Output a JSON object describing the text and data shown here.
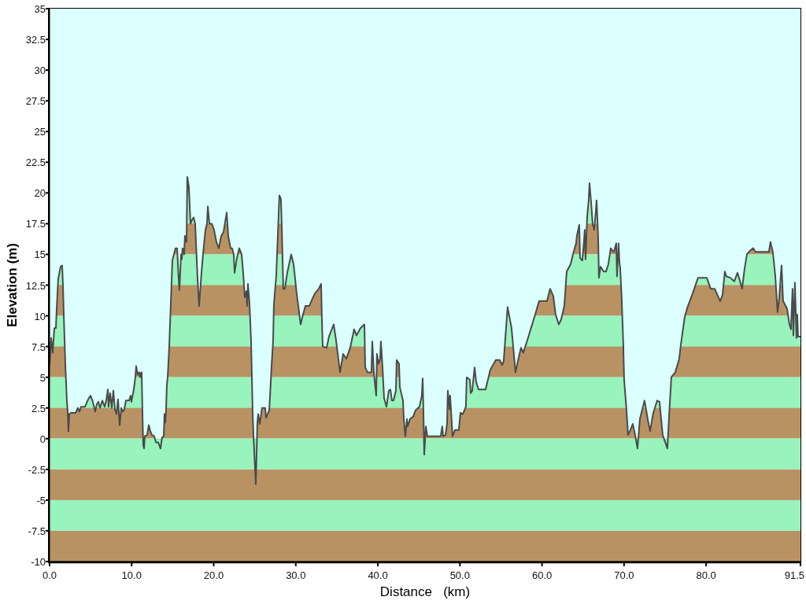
{
  "chart": {
    "chart_data": {
      "type": "area",
      "xlabel": "Distance   (km)",
      "ylabel": "Elevation (m)",
      "x": [
        0,
        0.19,
        0.38,
        0.58,
        0.77,
        0.86,
        1.05,
        1.34,
        1.53,
        1.63,
        1.73,
        1.92,
        2.11,
        2.21,
        2.3,
        2.4,
        2.59,
        3.16,
        3.45,
        3.64,
        3.84,
        4.32,
        4.7,
        4.99,
        5.27,
        5.56,
        5.75,
        5.95,
        6.14,
        6.43,
        6.71,
        6.9,
        7.1,
        7.19,
        7.38,
        7.58,
        7.77,
        7.96,
        8.15,
        8.34,
        8.54,
        8.73,
        8.92,
        9.11,
        9.3,
        9.69,
        9.88,
        9.97,
        10.26,
        10.45,
        10.55,
        10.74,
        10.93,
        11.03,
        11.12,
        11.22,
        11.32,
        11.41,
        11.51,
        11.6,
        11.89,
        12.08,
        12.28,
        12.47,
        12.75,
        12.95,
        13.23,
        13.52,
        13.71,
        13.91,
        14,
        14.1,
        14.19,
        14.29,
        14.39,
        14.58,
        14.77,
        14.96,
        15.15,
        15.34,
        15.54,
        15.73,
        15.82,
        16.02,
        16.11,
        16.21,
        16.4,
        16.49,
        16.69,
        16.78,
        16.97,
        17.07,
        17.17,
        17.36,
        17.55,
        17.74,
        18.03,
        18.22,
        18.51,
        18.7,
        18.99,
        19.18,
        19.28,
        19.47,
        19.76,
        20.04,
        20.33,
        20.62,
        20.91,
        21.19,
        21.48,
        21.58,
        21.77,
        22.06,
        22.25,
        22.44,
        22.54,
        22.82,
        23.11,
        23.4,
        23.59,
        23.78,
        23.98,
        24.07,
        24.17,
        24.36,
        24.55,
        24.65,
        24.74,
        24.84,
        25.13,
        25.32,
        25.42,
        25.61,
        25.89,
        26.28,
        26.37,
        26.76,
        26.85,
        27.04,
        27.24,
        27.33,
        27.62,
        27.81,
        28,
        28.19,
        28.29,
        28.48,
        28.67,
        28.96,
        29.44,
        29.73,
        30.11,
        30.4,
        30.59,
        30.88,
        31.17,
        31.65,
        32.03,
        32.32,
        32.8,
        33.09,
        33.18,
        33.28,
        33.76,
        34.04,
        34.62,
        34.91,
        35.39,
        35.77,
        36.15,
        36.63,
        37.11,
        37.4,
        37.88,
        38.36,
        38.46,
        38.74,
        39.22,
        39.32,
        39.51,
        39.8,
        39.89,
        40.09,
        40.28,
        40.37,
        40.57,
        40.76,
        41.05,
        41.33,
        41.53,
        41.72,
        41.91,
        42.2,
        42.29,
        42.58,
        42.68,
        43.06,
        43.16,
        43.35,
        43.54,
        43.63,
        43.92,
        44.31,
        44.59,
        45.07,
        45.36,
        45.46,
        45.55,
        45.65,
        45.84,
        46.03,
        47.66,
        47.85,
        47.95,
        48.24,
        48.43,
        48.53,
        48.72,
        48.81,
        49.1,
        49.39,
        49.87,
        50.06,
        50.35,
        50.73,
        50.83,
        51.21,
        51.31,
        51.5,
        51.79,
        51.98,
        52.27,
        53.13,
        53.7,
        54.38,
        54.85,
        55.14,
        55.33,
        55.81,
        56.29,
        56.77,
        57.06,
        57.44,
        57.73,
        58.21,
        59.17,
        59.65,
        60.61,
        60.99,
        61.38,
        61.66,
        62.05,
        62.34,
        62.72,
        63.01,
        63.49,
        63.77,
        64.16,
        64.25,
        64.54,
        64.64,
        64.92,
        65.12,
        65.21,
        65.31,
        65.5,
        65.69,
        65.79,
        65.98,
        66.17,
        66.36,
        66.55,
        66.65,
        66.84,
        66.94,
        67.13,
        67.51,
        67.8,
        68.09,
        68.38,
        68.57,
        68.76,
        69.05,
        69.14,
        69.34,
        69.43,
        69.53,
        69.72,
        69.91,
        70.01,
        70.29,
        70.49,
        70.77,
        71.06,
        71.35,
        71.64,
        71.93,
        72.5,
        72.88,
        73.17,
        73.56,
        74.04,
        74.32,
        74.71,
        75.28,
        75.47,
        75.76,
        76.24,
        76.72,
        76.91,
        77.39,
        77.68,
        78.35,
        79.02,
        80.08,
        80.56,
        81.04,
        81.71,
        82,
        82.28,
        82.47,
        82.95,
        83.43,
        83.82,
        84.1,
        84.39,
        84.68,
        84.97,
        85.35,
        85.73,
        86.02,
        87.65,
        87.84,
        88.13,
        88.42,
        88.71,
        88.9,
        89.19,
        89.38,
        89.86,
        90.15,
        90.34,
        90.53,
        90.63,
        90.82,
        91.01,
        91.11,
        91.2,
        91.5
      ],
      "values": [
        6,
        8.2,
        7,
        9,
        9,
        10.5,
        13,
        14,
        14.1,
        12.5,
        10,
        6,
        3,
        2.2,
        0.6,
        2,
        2.1,
        2.1,
        2.5,
        2.2,
        2.6,
        2.6,
        3.2,
        3.5,
        3,
        2.2,
        2.8,
        3,
        2.5,
        3.1,
        2.6,
        3.1,
        4,
        2.6,
        3.7,
        2.5,
        3.9,
        2.4,
        2,
        3.2,
        1.1,
        2.5,
        2.2,
        2.4,
        3.1,
        3.1,
        3.5,
        3,
        4,
        5,
        5.9,
        5.2,
        5.4,
        5,
        5.3,
        5.4,
        2,
        -0.5,
        -0.8,
        0.2,
        0.3,
        1.1,
        0.6,
        0.3,
        0.2,
        -0.3,
        -0.3,
        -0.8,
        0.1,
        0.2,
        2,
        1.3,
        2.3,
        4.4,
        5,
        7.5,
        11,
        14.5,
        15,
        15.5,
        15.5,
        13,
        12.1,
        15,
        14.6,
        15.5,
        15,
        16.5,
        16,
        21.3,
        20.5,
        19,
        17.5,
        17.8,
        18,
        17.5,
        13,
        10.8,
        13.5,
        15,
        17,
        17.5,
        18.9,
        17.5,
        17.5,
        17,
        16,
        15.5,
        16.5,
        16.8,
        18,
        18.4,
        16.5,
        15.5,
        15.5,
        15,
        13.5,
        14.7,
        15.5,
        15,
        13.5,
        11.5,
        12,
        10.8,
        12.6,
        11,
        8,
        5,
        2.2,
        0.3,
        -3.7,
        1.3,
        2,
        1.2,
        2.5,
        2.5,
        1.7,
        2.3,
        3.3,
        5.8,
        8,
        10.9,
        13.3,
        16.5,
        19.8,
        19.5,
        17.3,
        12.2,
        12.2,
        13.5,
        15,
        14.2,
        11.8,
        10.3,
        9.3,
        10.1,
        10.8,
        10.8,
        11.4,
        11.8,
        12.2,
        12.6,
        9.7,
        7.5,
        7.4,
        8.3,
        9.3,
        8,
        5.4,
        6.9,
        6.5,
        7.4,
        8.9,
        8.4,
        9,
        9.3,
        5.8,
        5.4,
        5.4,
        7.9,
        5.4,
        3.5,
        6.9,
        6.1,
        6.5,
        7.9,
        5.8,
        3.3,
        2.6,
        3.9,
        4,
        3.1,
        3.1,
        3.9,
        6.4,
        6.1,
        4.2,
        3.1,
        1.6,
        0.2,
        1.6,
        1,
        1.6,
        1.8,
        2.3,
        2.6,
        3.5,
        4.9,
        2.4,
        -1.3,
        1,
        0.2,
        0.2,
        1,
        0.2,
        0.3,
        1.2,
        3.9,
        2.4,
        3.5,
        0.2,
        0.7,
        0.7,
        2.1,
        2,
        2.6,
        5,
        4.8,
        3.7,
        3.9,
        5.8,
        4.6,
        4,
        4,
        5.6,
        6.4,
        6.4,
        6,
        6.3,
        10.7,
        9,
        5.4,
        6.3,
        7.4,
        7,
        8,
        10.1,
        11.2,
        11.2,
        12.2,
        11.6,
        10.1,
        9.3,
        9.7,
        10.8,
        13.6,
        14.2,
        15,
        15.9,
        16.5,
        17.4,
        14.7,
        14.5,
        16.1,
        17,
        14.6,
        18,
        19.4,
        20.8,
        19.3,
        17.5,
        17,
        18.4,
        19.4,
        16.5,
        13.1,
        14,
        13.6,
        13.6,
        14.2,
        15.5,
        15.3,
        15.2,
        15.9,
        13.2,
        15.9,
        14.4,
        13.9,
        11.3,
        7.6,
        4.8,
        2.4,
        0.3,
        0.7,
        1.2,
        0.3,
        -0.8,
        1.6,
        3.1,
        1.6,
        0.6,
        2.1,
        3.1,
        3,
        0.3,
        -0.8,
        1.6,
        5,
        5.4,
        6.5,
        7.6,
        9.9,
        10.6,
        11.8,
        13.1,
        13.1,
        12.2,
        12.2,
        11.2,
        11.7,
        13.6,
        13.2,
        13.1,
        12.8,
        13.5,
        12.9,
        12.2,
        13.8,
        15,
        15.3,
        15.5,
        15.2,
        15.2,
        16,
        15.2,
        13.3,
        10.3,
        11.4,
        14.1,
        11.2,
        10.6,
        9.3,
        8.9,
        12.2,
        8.4,
        12.7,
        8.2,
        10.1,
        8.3,
        8.3
      ],
      "xlim": [
        0,
        91.5
      ],
      "ylim": [
        -10,
        35
      ],
      "xticks": [
        {
          "value": 0,
          "label": "0.0"
        },
        {
          "value": 10,
          "label": "10.0"
        },
        {
          "value": 20,
          "label": "20.0"
        },
        {
          "value": 30,
          "label": "30.0"
        },
        {
          "value": 40,
          "label": "40.0"
        },
        {
          "value": 50,
          "label": "50.0"
        },
        {
          "value": 60,
          "label": "60.0"
        },
        {
          "value": 70,
          "label": "70.0"
        },
        {
          "value": 80,
          "label": "80.0"
        },
        {
          "value": 91.5,
          "label": "91.5"
        }
      ],
      "yticks": [
        -10,
        -7.5,
        -5,
        -2.5,
        0,
        2.5,
        5,
        7.5,
        10,
        12.5,
        15,
        17.5,
        20,
        22.5,
        25,
        27.5,
        30,
        32.5,
        35
      ],
      "bands": [
        {
          "axis": "y",
          "from": -10,
          "to": -7.5,
          "color": "#b99264"
        },
        {
          "axis": "y",
          "from": -7.5,
          "to": -5,
          "color": "#98f4bc"
        },
        {
          "axis": "y",
          "from": -5,
          "to": -2.5,
          "color": "#b99264"
        },
        {
          "axis": "y",
          "from": -2.5,
          "to": 0,
          "color": "#98f4bc"
        }
      ]
    }
  }
}
